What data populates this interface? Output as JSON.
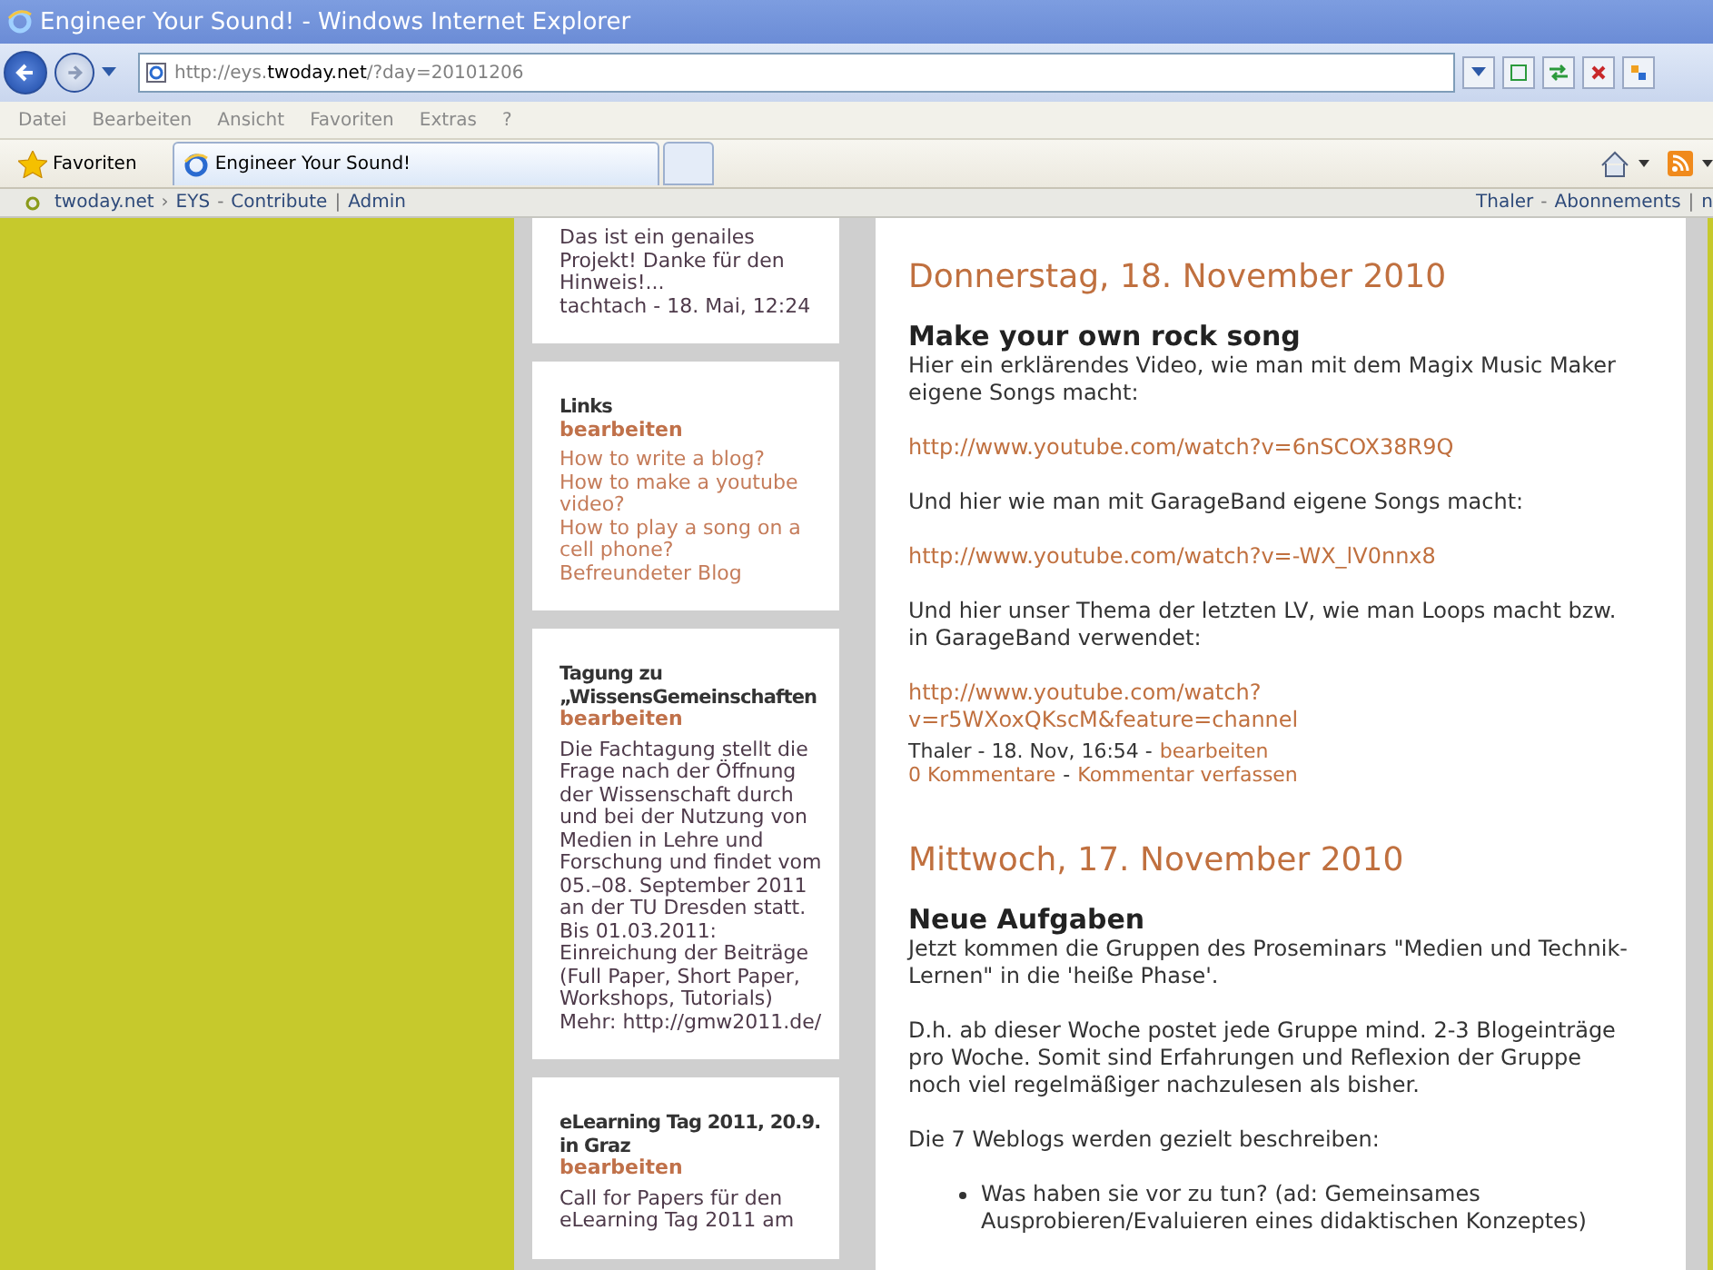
{
  "window": {
    "title": "Engineer Your Sound! - Windows Internet Explorer"
  },
  "address": {
    "prefix": "http://eys.",
    "domain": "twoday.net",
    "path": "/?day=20101206"
  },
  "menu": [
    "Datei",
    "Bearbeiten",
    "Ansicht",
    "Favoriten",
    "Extras",
    "?"
  ],
  "favorites": {
    "label": "Favoriten",
    "tabs": [
      {
        "label": "Engineer Your Sound!",
        "selected": true
      }
    ]
  },
  "site_bar": {
    "left": [
      {
        "kind": "link",
        "text": "twoday.net"
      },
      {
        "kind": "sep",
        "text": "›"
      },
      {
        "kind": "link",
        "text": "EYS"
      },
      {
        "kind": "sep",
        "text": "-"
      },
      {
        "kind": "link",
        "text": "Contribute"
      },
      {
        "kind": "sep",
        "text": "|"
      },
      {
        "kind": "link",
        "text": "Admin"
      }
    ],
    "right": [
      {
        "kind": "link",
        "text": "Thaler"
      },
      {
        "kind": "sep",
        "text": "-"
      },
      {
        "kind": "link",
        "text": "Abonnements"
      },
      {
        "kind": "sep",
        "text": "|"
      },
      {
        "kind": "link",
        "text": "n"
      }
    ]
  },
  "sidebar": [
    {
      "lines": [
        {
          "kind": "text",
          "text": "Das ist ein genailes Projekt! Danke für den Hinweis!..."
        },
        {
          "kind": "text",
          "text": "tachtach - 18. Mai, 12:24"
        }
      ]
    },
    {
      "title": "Links",
      "edit": "bearbeiten",
      "lines": [
        {
          "kind": "link",
          "text": "How to write a blog?"
        },
        {
          "kind": "link",
          "text": "How to make a youtube video?"
        },
        {
          "kind": "link",
          "text": "How to play a song on a cell phone?"
        },
        {
          "kind": "link",
          "text": "Befreundeter Blog"
        }
      ]
    },
    {
      "title": "Tagung zu „WissensGemeinschaften",
      "edit": "bearbeiten",
      "lines": [
        {
          "kind": "text",
          "text": "Die Fachtagung stellt die Frage nach der Öffnung der Wissenschaft durch und bei der Nutzung von Medien in Lehre und Forschung und findet vom 05.–08. September 2011 an der TU Dresden statt. Bis 01.03.2011: Einreichung der Beiträge (Full Paper, Short Paper, Workshops, Tutorials) Mehr: http://gmw2011.de/"
        }
      ]
    },
    {
      "title": "eLearning Tag 2011, 20.9. in Graz",
      "edit": "bearbeiten",
      "lines": [
        {
          "kind": "text",
          "text": "Call for Papers für den eLearning Tag 2011 am"
        }
      ]
    }
  ],
  "days": [
    {
      "date": "Donnerstag, 18. November 2010",
      "posts": [
        {
          "title": "Make your own rock song",
          "blocks": [
            {
              "kind": "text",
              "text": "Hier ein erklärendes Video, wie man mit dem Magix Music Maker eigene Songs macht:"
            },
            {
              "kind": "link",
              "text": "http://www.youtube.com/watch?v=6nSCOX38R9Q"
            },
            {
              "kind": "text",
              "text": "Und hier wie man mit GarageBand eigene Songs macht:"
            },
            {
              "kind": "link",
              "text": "http://www.youtube.com/watch?v=-WX_lV0nnx8"
            },
            {
              "kind": "text",
              "text": "Und hier unser Thema der letzten LV, wie man Loops macht bzw. in GarageBand verwendet:"
            },
            {
              "kind": "link",
              "text": "http://www.youtube.com/watch? v=r5WXoxQKscM&feature=channel"
            }
          ],
          "meta": {
            "byline": "Thaler - 18. Nov, 16:54 -",
            "edit": "bearbeiten",
            "comments": "0 Kommentare",
            "sep": "-",
            "write": "Kommentar verfassen"
          }
        }
      ]
    },
    {
      "date": "Mittwoch, 17. November 2010",
      "posts": [
        {
          "title": "Neue Aufgaben",
          "blocks": [
            {
              "kind": "text",
              "text": "Jetzt kommen die Gruppen des Proseminars \"Medien und Technik-Lernen\" in die 'heiße Phase'."
            },
            {
              "kind": "text",
              "text": "D.h. ab dieser Woche postet jede Gruppe mind. 2-3 Blogeinträge pro Woche. Somit sind Erfahrungen und Reflexion der Gruppe noch viel regelmäßiger nachzulesen als bisher."
            },
            {
              "kind": "text",
              "text": "Die 7 Weblogs werden gezielt beschreiben:"
            },
            {
              "kind": "bullet",
              "text": "Was haben sie vor zu tun? (ad: Gemeinsames Ausprobieren/Evaluieren eines didaktischen Konzeptes)"
            }
          ]
        }
      ]
    }
  ]
}
